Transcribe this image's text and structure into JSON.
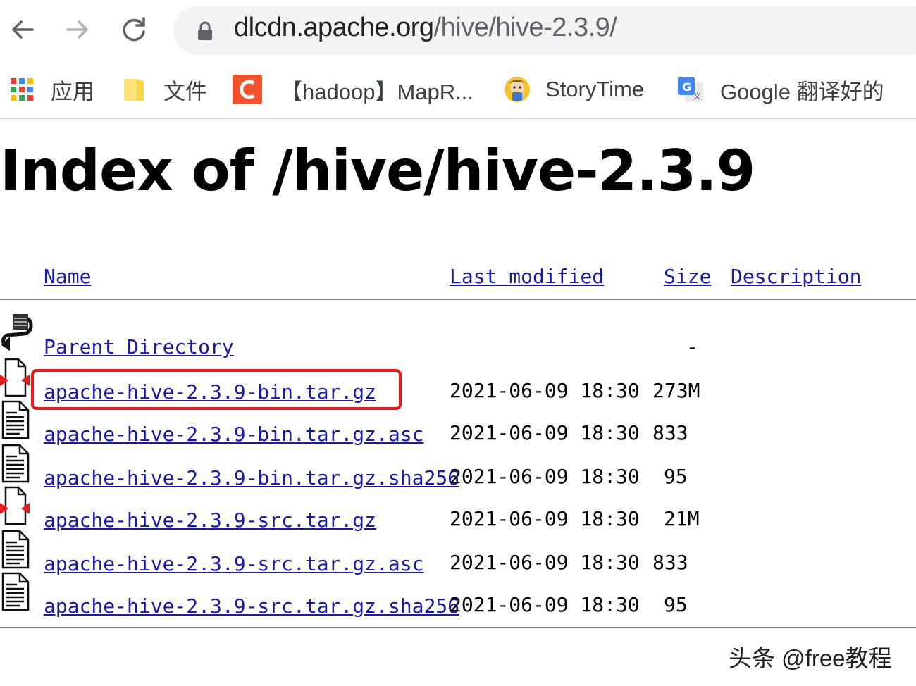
{
  "browser": {
    "url_host": "dlcdn.apache.org",
    "url_path": "/hive/hive-2.3.9/",
    "bookmarks": [
      {
        "label": "应用",
        "icon": "apps-grid-icon"
      },
      {
        "label": "文件",
        "icon": "folder-icon"
      },
      {
        "label": "【hadoop】MapR...",
        "icon": "csdn-icon"
      },
      {
        "label": "StoryTime",
        "icon": "storytime-icon"
      },
      {
        "label": "Google 翻译好的",
        "icon": "google-translate-icon"
      }
    ]
  },
  "page": {
    "title": "Index of /hive/hive-2.3.9",
    "columns": {
      "name": "Name",
      "last_modified": "Last modified",
      "size": "Size",
      "description": "Description"
    },
    "parent": {
      "name": "Parent Directory",
      "size": "-"
    },
    "files": [
      {
        "name": "apache-hive-2.3.9-bin.tar.gz",
        "modified": "2021-06-09 18:30",
        "size": "273M",
        "icon": "compressed-file-icon"
      },
      {
        "name": "apache-hive-2.3.9-bin.tar.gz.asc",
        "modified": "2021-06-09 18:30",
        "size": "833",
        "icon": "text-file-icon"
      },
      {
        "name": "apache-hive-2.3.9-bin.tar.gz.sha256",
        "modified": "2021-06-09 18:30",
        "size": "95",
        "icon": "text-file-icon"
      },
      {
        "name": "apache-hive-2.3.9-src.tar.gz",
        "modified": "2021-06-09 18:30",
        "size": "21M",
        "icon": "compressed-file-icon"
      },
      {
        "name": "apache-hive-2.3.9-src.tar.gz.asc",
        "modified": "2021-06-09 18:30",
        "size": "833",
        "icon": "text-file-icon"
      },
      {
        "name": "apache-hive-2.3.9-src.tar.gz.sha256",
        "modified": "2021-06-09 18:30",
        "size": "95",
        "icon": "text-file-icon"
      }
    ]
  },
  "watermark": "头条 @free教程",
  "colors": {
    "link": "#1a1aa6",
    "highlight": "#e31c1c"
  }
}
